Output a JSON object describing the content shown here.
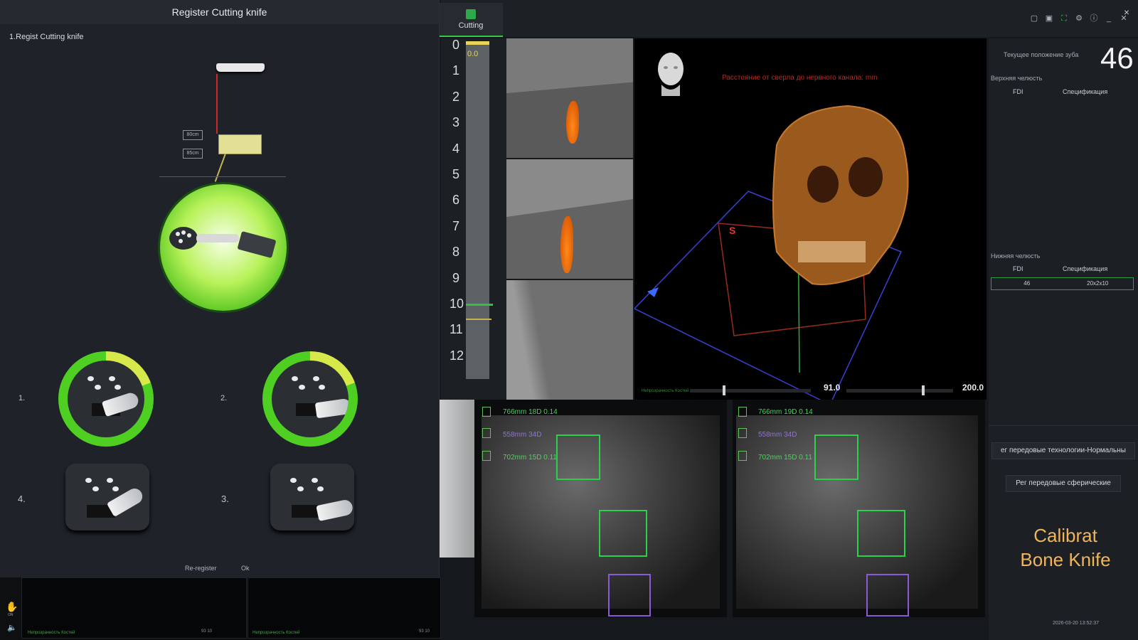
{
  "dialog": {
    "title": "Register Cutting knife",
    "close_label": "×",
    "step": "1.Regist Cutting knife",
    "dist_top": "80cm",
    "dist_bottom": "85cm",
    "positions": [
      "1.",
      "2.",
      "4.",
      "3."
    ],
    "reregister_label": "Re-register",
    "ok_label": "Ok"
  },
  "toolbar": {
    "tab_label": "Cutting"
  },
  "ruler": {
    "top_value": "0.0",
    "ticks": [
      "0",
      "1",
      "2",
      "3",
      "4",
      "5",
      "6",
      "7",
      "8",
      "9",
      "10",
      "11",
      "12"
    ]
  },
  "view3d": {
    "warning": "Расстояние от сверла до нервного канала: mm",
    "orientation_marker": "S",
    "slider_value_1": "91.0",
    "slider_value_2": "200.0",
    "slider_label": "Непрозрачность Костей"
  },
  "right_panel": {
    "tooth_label": "Текущее положение зуба",
    "tooth_number": "46",
    "upper_jaw": "Верхняя челюсть",
    "lower_jaw": "Нижняя челюсть",
    "fdi_header": "FDI",
    "spec_header": "Спецификация",
    "lower_row": {
      "fdi": "46",
      "spec": "20x2x10"
    },
    "btn_advanced_normal": "ег передовые технологии-Нормальны",
    "btn_advanced_spherical": "Рег передовые сферические",
    "calibration_title_line1": "Calibrat",
    "calibration_title_line2": "Bone Knife",
    "datetime": "2026-03-20 13:52:37"
  },
  "cameras": {
    "left": {
      "row1": "766mm  18D  0.14",
      "row2": "558mm  34D",
      "row3": "702mm  15D  0.11"
    },
    "right": {
      "row1": "766mm  19D  0.14",
      "row2": "558mm  34D",
      "row3": "702mm  15D  0.11"
    }
  },
  "lower_strip": {
    "hand_label": "ON",
    "pane1_label": "Непрозрачность Костей",
    "pane1_value": "93  10",
    "pane2_label": "Непрозрачность Костей",
    "pane2_value": "93  10"
  },
  "colors": {
    "accent_green": "#2bd14a",
    "warning_red": "#c2261e",
    "calibration_orange": "#f0b55a",
    "ruler_yellow": "#e8d45a"
  }
}
